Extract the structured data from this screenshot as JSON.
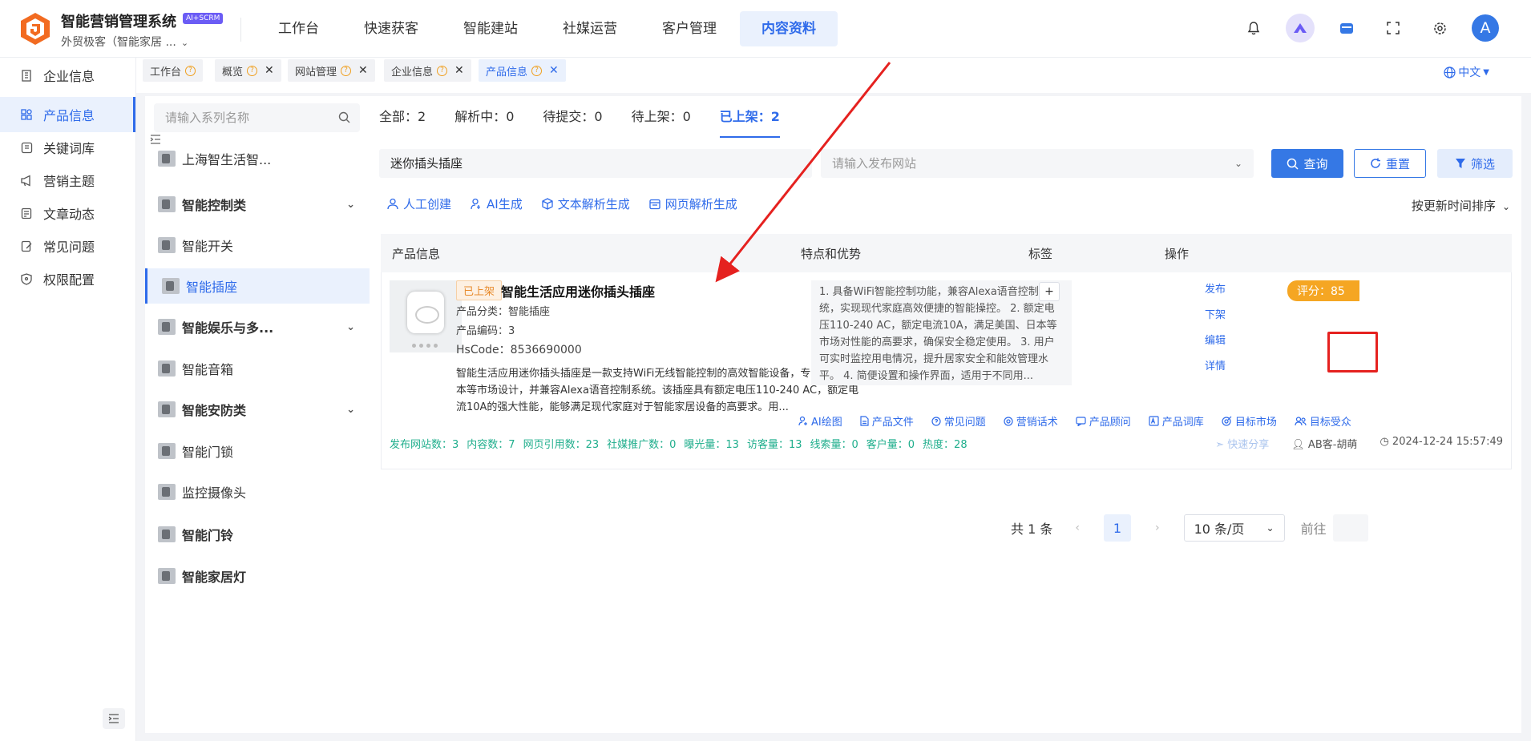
{
  "app": {
    "name": "智能营销管理系统",
    "tag": "AI+SCRM",
    "company": "外贸极客（智能家居 ..."
  },
  "nav": [
    "工作台",
    "快速获客",
    "智能建站",
    "社媒运营",
    "客户管理",
    "内容资料"
  ],
  "sidebar": [
    "企业信息",
    "产品信息",
    "关键词库",
    "营销主题",
    "文章动态",
    "常见问题",
    "权限配置"
  ],
  "tabs": [
    "工作台",
    "概览",
    "网站管理",
    "企业信息",
    "产品信息"
  ],
  "lang": "中文",
  "series_panel": {
    "search_placeholder": "请输入系列名称",
    "items": [
      "上海智生活智...",
      "智能控制类",
      "智能开关",
      "智能插座",
      "智能娱乐与多...",
      "智能音箱",
      "智能安防类",
      "智能门锁",
      "监控摄像头",
      "智能门铃",
      "智能家居灯"
    ]
  },
  "status_tabs": [
    "全部：2",
    "解析中：0",
    "待提交：0",
    "待上架：0",
    "已上架：2"
  ],
  "filters": {
    "keyword": "迷你插头插座",
    "site_placeholder": "请输入发布网站",
    "query": "查询",
    "reset": "重置",
    "filter": "筛选"
  },
  "create": [
    "人工创建",
    "AI生成",
    "文本解析生成",
    "网页解析生成"
  ],
  "sort": "按更新时间排序",
  "table_headers": [
    "产品信息",
    "特点和优势",
    "标签",
    "操作"
  ],
  "product": {
    "badge": "已上架",
    "name": "智能生活应用迷你插头插座",
    "category": "产品分类：智能插座",
    "code": "产品编码：3",
    "hscode": "HsCode：8536690000",
    "desc": "智能生活应用迷你插头插座是一款支持WiFi无线智能控制的高效智能设备，专为美国、日本等市场设计，并兼容Alexa语音控制系统。该插座具有额定电压110-240 AC，额定电流10A的强大性能，能够满足现代家庭对于智能家居设备的高要求。用...",
    "features": "1. 具备WiFi智能控制功能，兼容Alexa语音控制系统，实现现代家庭高效便捷的智能操控。 2. 额定电压110-240 AC，额定电流10A，满足美国、日本等市场对性能的高要求，确保安全稳定使用。 3. 用户可实时监控用电情况，提升居家安全和能效管理水平。 4. 简便设置和操作界面，适用于不同用...",
    "tag_add": "+",
    "ops": [
      "发布",
      "下架",
      "编辑",
      "详情"
    ],
    "score": "评分：85",
    "links": [
      "AI绘图",
      "产品文件",
      "常见问题",
      "营销话术",
      "产品顾问",
      "产品词库",
      "目标市场",
      "目标受众"
    ],
    "stats": [
      "发布网站数：3",
      "内容数：7",
      "网页引用数：23",
      "社媒推广数：0",
      "曝光量：13",
      "访客量：13",
      "线索量：0",
      "客户量：0",
      "热度：28"
    ],
    "share": "快速分享",
    "user": "AB客-胡萌",
    "time": "2024-12-24 15:57:49"
  },
  "pager": {
    "total": "共 1 条",
    "page": "1",
    "size": "10 条/页",
    "goto": "前往"
  },
  "colors": {
    "accent": "#3578e5",
    "highlight": "#e5211f",
    "badge": "#e88b2d",
    "score": "#f5a623",
    "stats": "#1fae8c"
  }
}
